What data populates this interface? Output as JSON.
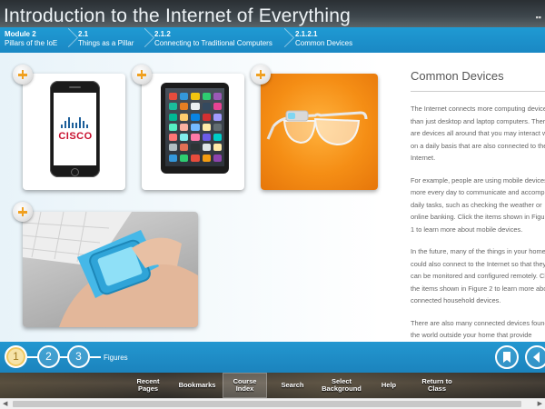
{
  "header": {
    "title": "Introduction to the Internet of Everything"
  },
  "breadcrumb": [
    {
      "num": "Module 2",
      "label": "Pillars of the IoE"
    },
    {
      "num": "2.1",
      "label": "Things as a Pillar"
    },
    {
      "num": "2.1.2",
      "label": "Connecting to Traditional Computers"
    },
    {
      "num": "2.1.2.1",
      "label": "Common Devices"
    }
  ],
  "figures": {
    "cards": [
      {
        "name": "smartphone",
        "brand": "CISCO"
      },
      {
        "name": "tablet"
      },
      {
        "name": "smart-glasses"
      },
      {
        "name": "smartwatch"
      }
    ],
    "icons": {
      "plus": "plus-circle-icon",
      "bookmark": "bookmark-icon",
      "back": "back-arrow-icon"
    },
    "colors": {
      "accent": "#1f9ad3",
      "plus": "#f0a020",
      "glasses_bg": "#f58e15",
      "watch_band": "#45b8e8"
    }
  },
  "panel": {
    "heading": "Common Devices",
    "paragraphs": [
      "The Internet connects more computing devices than just desktop and laptop computers. There are devices all around that you may interact with on a daily basis that are also connected to the Internet.",
      "For example, people are using mobile devices more every day to communicate and accomplish daily tasks, such as checking the weather or online banking. Click the items shown in Figure 1 to learn more about mobile devices.",
      "In the future, many of the things in your home could also connect to the Internet so that they can be monitored and configured remotely. Click the items shown in Figure 2 to learn more about connected household devices.",
      "There are also many connected devices found in the world outside your home that provide convenience and useful or even vital information. Click the items shown in Figure 3"
    ]
  },
  "figbar": {
    "steps": [
      "1",
      "2",
      "3"
    ],
    "active_step": "1",
    "label": "Figures"
  },
  "nav": {
    "items": [
      {
        "line1": "Recent",
        "line2": "Pages"
      },
      {
        "line1": "Bookmarks",
        "line2": ""
      },
      {
        "line1": "Course",
        "line2": "Index"
      },
      {
        "line1": "Search",
        "line2": ""
      },
      {
        "line1": "Select",
        "line2": "Background"
      },
      {
        "line1": "Help",
        "line2": ""
      },
      {
        "line1": "Return to",
        "line2": "Class"
      }
    ],
    "selected": "Course Index"
  }
}
